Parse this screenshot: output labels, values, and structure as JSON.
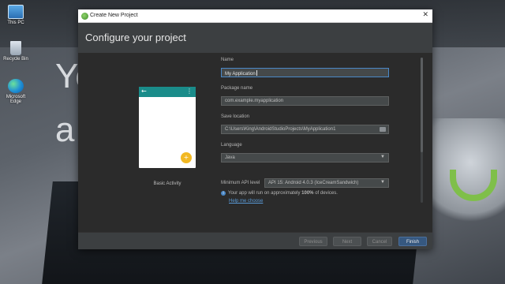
{
  "desktop": {
    "icons": [
      {
        "label": "This PC",
        "icon": "computer-icon"
      },
      {
        "label": "Recycle Bin",
        "icon": "recycle-bin-icon"
      },
      {
        "label": "Microsoft Edge",
        "icon": "edge-icon"
      }
    ],
    "wallpaper_text": [
      "Yo",
      "a"
    ]
  },
  "dialog": {
    "title": "Create New Project",
    "close_glyph": "✕",
    "heading": "Configure your project",
    "template": {
      "label": "Basic Activity",
      "back_glyph": "←",
      "more_glyph": "⋮",
      "fab_glyph": "+",
      "accent_color": "#1a8c8a",
      "fab_color": "#f2b822"
    },
    "form": {
      "name": {
        "label": "Name",
        "value": "My Application"
      },
      "package": {
        "label": "Package name",
        "value": "com.example.myapplication"
      },
      "save_location": {
        "label": "Save location",
        "value": "C:\\Users\\King\\AndroidStudioProjects\\MyApplication1"
      },
      "language": {
        "label": "Language",
        "value": "Java"
      },
      "min_api": {
        "label": "Minimum API level",
        "value": "API 15: Android 4.0.3 (IceCreamSandwich)"
      },
      "info_text": "Your app will run on approximately ",
      "info_bold": "100%",
      "info_suffix": " of devices.",
      "help_link": "Help me choose"
    },
    "buttons": {
      "previous": "Previous",
      "next": "Next",
      "cancel": "Cancel",
      "finish": "Finish"
    }
  }
}
